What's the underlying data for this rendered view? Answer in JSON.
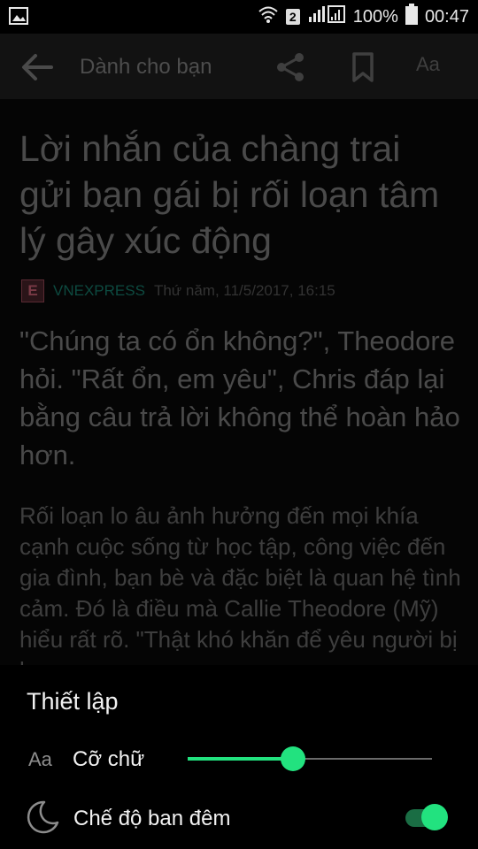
{
  "status_bar": {
    "sim_slot": "2",
    "battery": "100%",
    "time": "00:47",
    "icons": [
      "image-icon",
      "wifi-icon",
      "signal-icon",
      "battery-icon"
    ]
  },
  "toolbar": {
    "title": "Dành cho bạn",
    "font_button": "Aa"
  },
  "article": {
    "title": "Lời nhắn của chàng trai gửi bạn gái bị rối loạn tâm lý gây xúc động",
    "source_logo": "E",
    "source": "VNEXPRESS",
    "date": "Thứ năm, 11/5/2017, 16:15",
    "lead": "\"Chúng ta có ổn không?\", Theodore hỏi. \"Rất ổn, em yêu\", Chris đáp lại bằng câu trả lời không thể hoàn hảo hơn.",
    "body": "Rối loạn lo âu ảnh hưởng đến mọi khía cạnh cuộc sống từ học tập, công việc đến gia đình, bạn bè và đặc biệt là quan hệ tình cảm. Đó là điều mà Callie Theodore (Mỹ) hiểu rất rõ. \"Thật khó khăn để yêu người bị lo"
  },
  "settings": {
    "title": "Thiết lập",
    "font_size_icon": "Aa",
    "font_size_label": "Cỡ chữ",
    "font_size_level": 0.43,
    "night_mode_label": "Chế độ ban đêm",
    "night_mode_on": true
  },
  "colors": {
    "accent": "#22e27f",
    "toolbar_bg": "#121212",
    "source_color": "#0d4a40"
  }
}
